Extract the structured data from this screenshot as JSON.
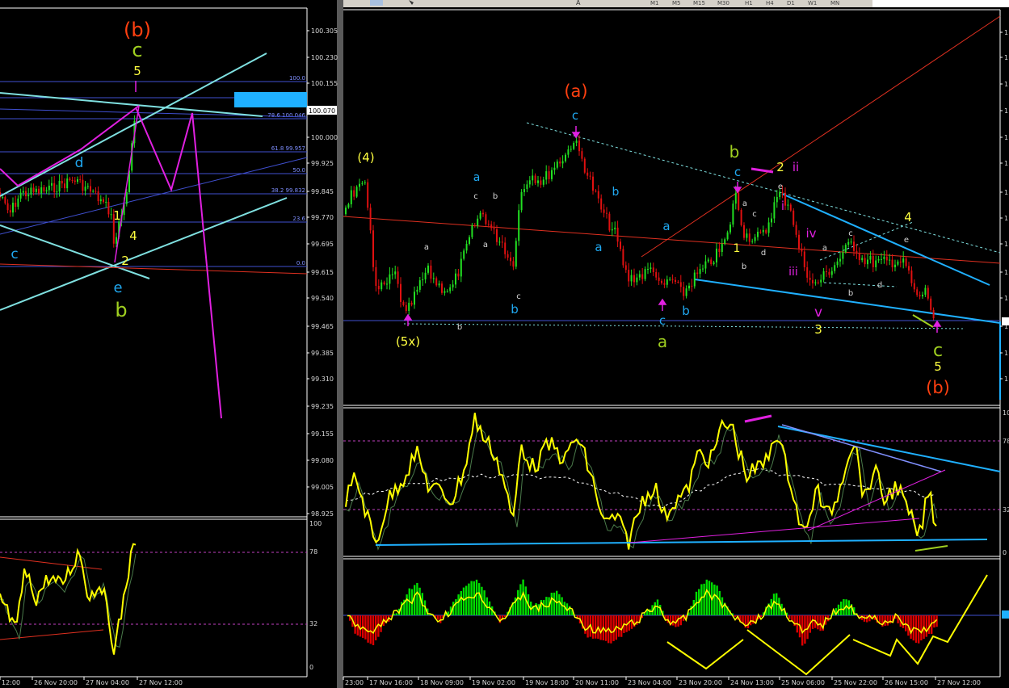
{
  "colors": {
    "background": "#000000",
    "bull_candle": "#22e022",
    "bear_candle": "#e01010",
    "grid_line": "#ffffff",
    "channel": "#7fe0e0",
    "trendline_blue": "#1fb0ff",
    "magenta": "#e020e0",
    "fib": "#3f4fd0",
    "rsi_line": "#ffff00",
    "histogram_pos": "#00dd00",
    "histogram_neg": "#dd0000",
    "orange_label": "#ff4010",
    "yellow_label": "#ffff40",
    "green_label": "#a0d020",
    "cyan_label": "#20a8f0"
  },
  "toolbar": {
    "timeframes": [
      "M1",
      "M5",
      "M15",
      "M30",
      "H1",
      "H4",
      "D1",
      "W1",
      "MN"
    ],
    "tool_letters": [
      "A"
    ]
  },
  "left_chart": {
    "price_ticks": [
      "100.305",
      "100.230",
      "100.155",
      "100.070",
      "100.000",
      "99.925",
      "99.845",
      "99.770",
      "99.695",
      "99.615",
      "99.540",
      "99.465",
      "99.385",
      "99.310",
      "99.235",
      "99.155",
      "99.080",
      "99.005",
      "98.925"
    ],
    "price_marker": "100.070",
    "fib_levels": [
      {
        "label": "100.0"
      },
      {
        "label": "88.6 100.099"
      },
      {
        "label": "78.6 100.046"
      },
      {
        "label": "61.8 99.957"
      },
      {
        "label": "50.0"
      },
      {
        "label": "38.2 99.832"
      },
      {
        "label": "23.6"
      },
      {
        "label": "0.0"
      }
    ],
    "wave_labels": [
      {
        "text": "(b)",
        "color": "#ff4010"
      },
      {
        "text": "c",
        "color": "#a0d020"
      },
      {
        "text": "5",
        "color": "#ffff40"
      },
      {
        "text": "d",
        "color": "#20a8f0"
      },
      {
        "text": "1",
        "color": "#ffff40"
      },
      {
        "text": "4",
        "color": "#ffff40"
      },
      {
        "text": "2",
        "color": "#ffff40"
      },
      {
        "text": "c",
        "color": "#20a8f0"
      },
      {
        "text": "e",
        "color": "#20a8f0"
      },
      {
        "text": "b",
        "color": "#a0d020"
      }
    ],
    "osc_ticks": [
      "100",
      "78",
      "32",
      "0"
    ],
    "time_labels": [
      "12:00",
      "26 Nov 20:00",
      "27 Nov 04:00",
      "27 Nov 12:00"
    ]
  },
  "right_chart": {
    "price_ticks_partial": [
      "1",
      "1",
      "1",
      "1",
      "1",
      "1",
      "1",
      "1",
      "1",
      "1",
      "1",
      "1",
      "1",
      "1"
    ],
    "osc_ticks": [
      "10",
      "78",
      "32",
      "0"
    ],
    "wave_labels": [
      {
        "text": "(a)",
        "color": "#ff4010"
      },
      {
        "text": "c",
        "color": "#20a8f0"
      },
      {
        "text": "(4)",
        "color": "#ffff40"
      },
      {
        "text": "a",
        "color": "#20a8f0"
      },
      {
        "text": "c",
        "color": "#d8d8d8"
      },
      {
        "text": "b",
        "color": "#d8d8d8"
      },
      {
        "text": "a",
        "color": "#d8d8d8"
      },
      {
        "text": "a",
        "color": "#d8d8d8"
      },
      {
        "text": "c",
        "color": "#d8d8d8"
      },
      {
        "text": "b",
        "color": "#20a8f0"
      },
      {
        "text": "b",
        "color": "#20a8f0"
      },
      {
        "text": "a",
        "color": "#20a8f0"
      },
      {
        "text": "a",
        "color": "#20a8f0"
      },
      {
        "text": "c",
        "color": "#20a8f0"
      },
      {
        "text": "b",
        "color": "#20a8f0"
      },
      {
        "text": "a",
        "color": "#a0d020"
      },
      {
        "text": "(5x)",
        "color": "#ffff40"
      },
      {
        "text": "b",
        "color": "#d8d8d8"
      },
      {
        "text": "b",
        "color": "#a0d020"
      },
      {
        "text": "c",
        "color": "#20a8f0"
      },
      {
        "text": "2",
        "color": "#ffff40"
      },
      {
        "text": "a",
        "color": "#d8d8d8"
      },
      {
        "text": "c",
        "color": "#d8d8d8"
      },
      {
        "text": "e",
        "color": "#d8d8d8"
      },
      {
        "text": "1",
        "color": "#ffff40"
      },
      {
        "text": "b",
        "color": "#d8d8d8"
      },
      {
        "text": "d",
        "color": "#d8d8d8"
      },
      {
        "text": "ii",
        "color": "#e020e0"
      },
      {
        "text": "i",
        "color": "#e020e0"
      },
      {
        "text": "iii",
        "color": "#e020e0"
      },
      {
        "text": "iv",
        "color": "#e020e0"
      },
      {
        "text": "v",
        "color": "#e020e0"
      },
      {
        "text": "3",
        "color": "#ffff40"
      },
      {
        "text": "a",
        "color": "#d8d8d8"
      },
      {
        "text": "c",
        "color": "#d8d8d8"
      },
      {
        "text": "e",
        "color": "#d8d8d8"
      },
      {
        "text": "b",
        "color": "#d8d8d8"
      },
      {
        "text": "d",
        "color": "#d8d8d8"
      },
      {
        "text": "4",
        "color": "#ffff40"
      },
      {
        "text": "c",
        "color": "#a0d020"
      },
      {
        "text": "5",
        "color": "#ffff40"
      },
      {
        "text": "(b)",
        "color": "#ff4010"
      }
    ],
    "time_labels": [
      "23:00",
      "17 Nov 16:00",
      "18 Nov 09:00",
      "19 Nov 02:00",
      "19 Nov 18:00",
      "20 Nov 11:00",
      "23 Nov 04:00",
      "23 Nov 20:00",
      "24 Nov 13:00",
      "25 Nov 06:00",
      "25 Nov 22:00",
      "26 Nov 15:00",
      "27 Nov 12:00"
    ]
  },
  "chart_data": [
    {
      "type": "line",
      "chart": "left-price",
      "ylim": [
        98.925,
        100.305
      ],
      "y_ticks": [
        100.305,
        100.23,
        100.155,
        100.07,
        100.0,
        99.925,
        99.845,
        99.77,
        99.695,
        99.615,
        99.54,
        99.465,
        99.385,
        99.31,
        99.235,
        99.155,
        99.08,
        99.005,
        98.925
      ],
      "fib_retracement": [
        {
          "level": 100.0
        },
        {
          "level": 88.6,
          "price": 100.099
        },
        {
          "level": 78.6,
          "price": 100.046
        },
        {
          "level": 61.8,
          "price": 99.957
        },
        {
          "level": 50.0
        },
        {
          "level": 38.2,
          "price": 99.832
        },
        {
          "level": 23.6
        },
        {
          "level": 0.0
        }
      ]
    },
    {
      "type": "line",
      "chart": "right-price",
      "x": [
        "23:00",
        "17 Nov 16:00",
        "18 Nov 09:00",
        "19 Nov 02:00",
        "19 Nov 18:00",
        "20 Nov 11:00",
        "23 Nov 04:00",
        "23 Nov 20:00",
        "24 Nov 13:00",
        "25 Nov 06:00",
        "25 Nov 22:00",
        "26 Nov 15:00",
        "27 Nov 12:00"
      ]
    },
    {
      "type": "line",
      "chart": "oscillator",
      "ylim": [
        0,
        100
      ],
      "levels": [
        78,
        32
      ]
    }
  ]
}
